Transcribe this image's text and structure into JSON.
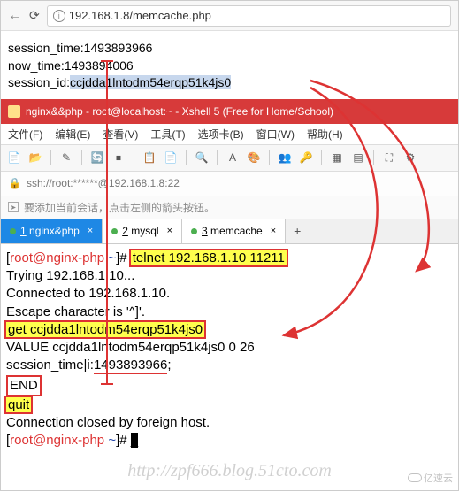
{
  "browser": {
    "url": "192.168.1.8/memcache.php"
  },
  "page": {
    "line1_label": "session_time:",
    "line1_val": "1493893966",
    "line2_label": "now_time:",
    "line2_val": "1493894006",
    "line3_label": "session_id:",
    "line3_val": "ccjdda1lntodm54erqp51k4js0"
  },
  "xshell": {
    "title": "nginx&&php - root@localhost:~ - Xshell 5 (Free for Home/School)",
    "menu": [
      "文件(F)",
      "编辑(E)",
      "查看(V)",
      "工具(T)",
      "选项卡(B)",
      "窗口(W)",
      "帮助(H)"
    ],
    "session": "ssh://root:******@192.168.1.8:22",
    "tip": "要添加当前会话，点击左侧的箭头按钮。"
  },
  "tabs": [
    {
      "idx": "1",
      "label": "nginx&php",
      "active": true
    },
    {
      "idx": "2",
      "label": "mysql",
      "active": false
    },
    {
      "idx": "3",
      "label": "memcache",
      "active": false
    }
  ],
  "terminal": {
    "prompt1_user": "root@nginx-php",
    "prompt1_path": "~",
    "cmd1": "telnet 192.168.1.10 11211",
    "out1": "Trying 192.168.1.10...",
    "out2": "Connected to 192.168.1.10.",
    "out3": "Escape character is '^]'.",
    "cmd2": "get ccjdda1lntodm54erqp51k4js0",
    "out4": "VALUE ccjdda1lntodm54erqp51k4js0 0 26",
    "out5a": "session_time|i:",
    "out5b": "1493893966",
    "out5c": ";",
    "out6": "END",
    "cmd3": "quit",
    "out7": "Connection closed by foreign host.",
    "prompt2_user": "root@nginx-php",
    "prompt2_path": "~"
  },
  "watermark": "http://zpf666.blog.51cto.com",
  "logo": "亿速云"
}
